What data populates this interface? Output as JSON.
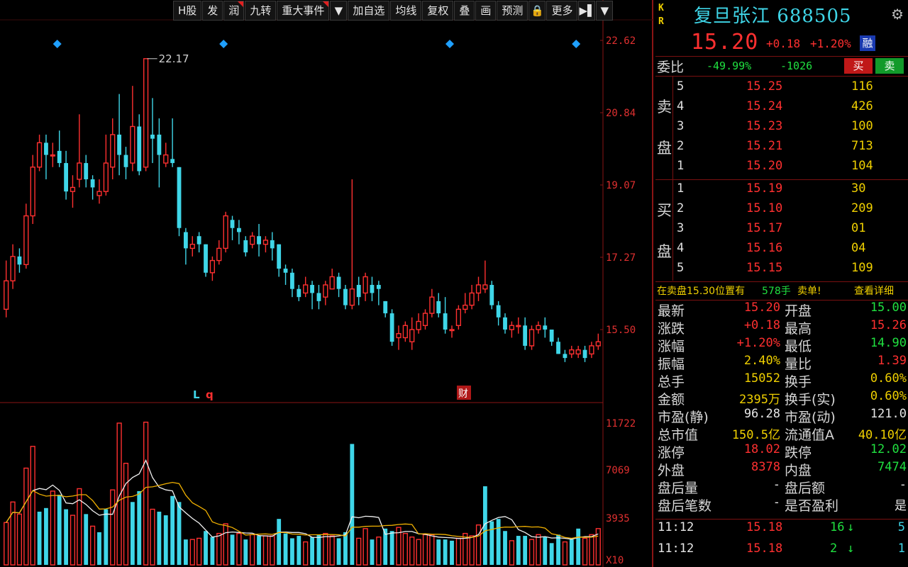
{
  "toolbar": {
    "items": [
      "H股",
      "发",
      "润",
      "九转",
      "重大事件",
      "▼",
      "加自选",
      "均线",
      "复权",
      "叠",
      "画",
      "预测",
      "🔒",
      "更多",
      "▶▌",
      "▼"
    ]
  },
  "colors": {
    "up": "#ff3030",
    "down": "#3fd6e8",
    "axis": "#e03030",
    "ma5": "#f0f0f0",
    "ma10": "#f0b000"
  },
  "chart": {
    "price_axis": [
      "22.62",
      "20.84",
      "19.07",
      "17.27",
      "15.50"
    ],
    "volume_axis": [
      "11722",
      "7069",
      "3935",
      "X10"
    ],
    "peak_label": "22.17",
    "markers": [
      "L",
      "q",
      "财"
    ]
  },
  "chart_data": {
    "type": "candlestick",
    "ylim": [
      14.6,
      22.62
    ],
    "candles": [
      [
        16.0,
        16.7,
        15.8,
        17.2
      ],
      [
        16.7,
        17.3,
        16.5,
        17.6
      ],
      [
        17.3,
        17.1,
        16.9,
        17.5
      ],
      [
        17.1,
        18.3,
        17.0,
        18.6
      ],
      [
        18.3,
        19.5,
        18.1,
        19.8
      ],
      [
        19.5,
        20.1,
        19.4,
        20.3
      ],
      [
        20.1,
        19.8,
        19.2,
        20.3
      ],
      [
        19.8,
        19.8,
        19.5,
        20.1
      ],
      [
        19.9,
        19.6,
        19.5,
        20.4
      ],
      [
        19.6,
        18.9,
        18.7,
        19.9
      ],
      [
        18.9,
        19.0,
        18.5,
        19.3
      ],
      [
        19.2,
        19.6,
        19.0,
        20.8
      ],
      [
        19.6,
        19.2,
        19.0,
        19.8
      ],
      [
        19.2,
        19.0,
        18.7,
        19.3
      ],
      [
        18.8,
        18.9,
        18.6,
        19.2
      ],
      [
        18.9,
        19.6,
        18.8,
        20.3
      ],
      [
        19.5,
        20.3,
        19.2,
        20.7
      ],
      [
        20.3,
        19.8,
        19.3,
        21.3
      ],
      [
        19.8,
        19.5,
        19.2,
        20.0
      ],
      [
        19.6,
        20.5,
        19.4,
        21.5
      ],
      [
        20.5,
        19.4,
        19.3,
        20.8
      ],
      [
        19.5,
        22.17,
        19.4,
        22.17
      ],
      [
        20.3,
        20.2,
        19.6,
        21.2
      ],
      [
        20.3,
        19.8,
        19.0,
        20.7
      ],
      [
        19.6,
        19.8,
        19.5,
        20.1
      ],
      [
        19.7,
        19.6,
        19.5,
        20.7
      ],
      [
        19.5,
        18.0,
        17.8,
        19.5
      ],
      [
        17.9,
        17.5,
        17.1,
        18.0
      ],
      [
        17.5,
        17.6,
        17.3,
        17.8
      ],
      [
        17.8,
        17.6,
        17.4,
        17.9
      ],
      [
        17.6,
        16.9,
        16.8,
        17.6
      ],
      [
        16.9,
        17.2,
        16.7,
        17.3
      ],
      [
        17.2,
        17.5,
        17.1,
        17.7
      ],
      [
        17.5,
        18.3,
        17.4,
        18.4
      ],
      [
        18.2,
        18.0,
        17.7,
        18.3
      ],
      [
        18.0,
        17.9,
        17.6,
        18.2
      ],
      [
        17.7,
        17.4,
        17.3,
        17.8
      ],
      [
        17.6,
        17.8,
        17.5,
        17.9
      ],
      [
        17.8,
        17.6,
        17.3,
        18.1
      ],
      [
        17.6,
        17.7,
        17.4,
        17.8
      ],
      [
        17.7,
        17.5,
        17.2,
        17.9
      ],
      [
        17.6,
        17.0,
        16.8,
        17.6
      ],
      [
        17.0,
        16.9,
        16.6,
        17.1
      ],
      [
        16.9,
        16.5,
        16.3,
        17.0
      ],
      [
        16.5,
        16.3,
        16.2,
        16.6
      ],
      [
        16.4,
        16.6,
        16.3,
        16.8
      ],
      [
        16.6,
        16.4,
        16.0,
        16.7
      ],
      [
        16.4,
        16.2,
        16.0,
        16.6
      ],
      [
        16.3,
        16.6,
        16.1,
        16.7
      ],
      [
        16.5,
        16.8,
        16.5,
        17.0
      ],
      [
        16.8,
        16.5,
        16.3,
        16.9
      ],
      [
        16.5,
        16.1,
        16.0,
        16.6
      ],
      [
        16.1,
        16.5,
        16.0,
        19.2
      ],
      [
        16.6,
        16.3,
        16.1,
        16.8
      ],
      [
        16.4,
        16.8,
        16.2,
        16.9
      ],
      [
        16.6,
        16.4,
        16.2,
        16.8
      ],
      [
        16.6,
        16.5,
        16.1,
        16.7
      ],
      [
        16.2,
        15.9,
        15.8,
        16.2
      ],
      [
        15.9,
        15.2,
        15.1,
        16.0
      ],
      [
        15.3,
        15.4,
        15.0,
        15.6
      ],
      [
        15.3,
        15.6,
        15.2,
        15.7
      ],
      [
        15.2,
        15.5,
        15.0,
        15.8
      ],
      [
        15.5,
        15.7,
        15.4,
        15.9
      ],
      [
        15.6,
        15.9,
        15.5,
        16.0
      ],
      [
        15.9,
        16.3,
        15.8,
        16.5
      ],
      [
        16.2,
        15.9,
        15.8,
        16.4
      ],
      [
        15.9,
        15.5,
        15.4,
        16.3
      ],
      [
        15.5,
        15.5,
        15.3,
        15.6
      ],
      [
        15.6,
        16.0,
        15.5,
        16.1
      ],
      [
        16.0,
        16.1,
        15.9,
        16.4
      ],
      [
        16.1,
        16.4,
        16.0,
        16.6
      ],
      [
        16.4,
        16.6,
        16.2,
        16.8
      ],
      [
        16.5,
        16.6,
        16.4,
        17.2
      ],
      [
        16.6,
        16.1,
        16.0,
        16.7
      ],
      [
        16.1,
        15.8,
        15.6,
        16.2
      ],
      [
        15.8,
        15.5,
        15.4,
        15.9
      ],
      [
        15.5,
        15.6,
        15.3,
        15.7
      ],
      [
        15.6,
        15.6,
        15.4,
        15.8
      ],
      [
        15.6,
        15.1,
        15.0,
        15.8
      ],
      [
        15.1,
        15.5,
        15.0,
        15.6
      ],
      [
        15.5,
        15.6,
        15.4,
        15.7
      ],
      [
        15.6,
        15.5,
        15.3,
        15.8
      ],
      [
        15.5,
        15.2,
        15.1,
        15.5
      ],
      [
        15.2,
        14.9,
        14.9,
        15.3
      ],
      [
        14.9,
        14.8,
        14.7,
        15.0
      ],
      [
        14.9,
        15.0,
        14.8,
        15.1
      ],
      [
        14.9,
        15.0,
        14.8,
        15.1
      ],
      [
        15.0,
        14.8,
        14.7,
        15.1
      ],
      [
        14.9,
        15.1,
        14.8,
        15.2
      ],
      [
        15.1,
        15.2,
        15.0,
        15.4
      ]
    ],
    "volumes": [
      [
        3500,
        1
      ],
      [
        5200,
        1
      ],
      [
        4200,
        1
      ],
      [
        8000,
        1
      ],
      [
        9800,
        1
      ],
      [
        4400,
        0
      ],
      [
        4700,
        0
      ],
      [
        6100,
        1
      ],
      [
        5800,
        0
      ],
      [
        4600,
        0
      ],
      [
        4100,
        1
      ],
      [
        6300,
        1
      ],
      [
        4200,
        0
      ],
      [
        3200,
        1
      ],
      [
        2700,
        0
      ],
      [
        4600,
        0
      ],
      [
        6200,
        1
      ],
      [
        11722,
        1
      ],
      [
        8400,
        1
      ],
      [
        5200,
        0
      ],
      [
        6100,
        0
      ],
      [
        11800,
        1
      ],
      [
        4600,
        1
      ],
      [
        4400,
        0
      ],
      [
        4100,
        0
      ],
      [
        5700,
        0
      ],
      [
        5200,
        0
      ],
      [
        2100,
        0
      ],
      [
        2100,
        1
      ],
      [
        2200,
        1
      ],
      [
        2800,
        0
      ],
      [
        2300,
        0
      ],
      [
        2600,
        1
      ],
      [
        3400,
        1
      ],
      [
        2500,
        0
      ],
      [
        2600,
        1
      ],
      [
        2100,
        0
      ],
      [
        2500,
        1
      ],
      [
        2400,
        0
      ],
      [
        2400,
        1
      ],
      [
        2400,
        1
      ],
      [
        3800,
        0
      ],
      [
        2600,
        0
      ],
      [
        2200,
        0
      ],
      [
        2400,
        0
      ],
      [
        1900,
        1
      ],
      [
        2300,
        0
      ],
      [
        2500,
        0
      ],
      [
        2600,
        1
      ],
      [
        2400,
        1
      ],
      [
        2200,
        0
      ],
      [
        2700,
        0
      ],
      [
        10000,
        0
      ],
      [
        2200,
        1
      ],
      [
        3000,
        1
      ],
      [
        2100,
        0
      ],
      [
        2300,
        1
      ],
      [
        3000,
        0
      ],
      [
        2800,
        0
      ],
      [
        3100,
        1
      ],
      [
        2600,
        1
      ],
      [
        2300,
        1
      ],
      [
        2100,
        1
      ],
      [
        2500,
        1
      ],
      [
        2500,
        1
      ],
      [
        2100,
        0
      ],
      [
        2100,
        0
      ],
      [
        2000,
        0
      ],
      [
        2200,
        1
      ],
      [
        2600,
        1
      ],
      [
        2400,
        1
      ],
      [
        3300,
        1
      ],
      [
        6500,
        0
      ],
      [
        3600,
        0
      ],
      [
        3800,
        0
      ],
      [
        2800,
        0
      ],
      [
        2000,
        1
      ],
      [
        2400,
        0
      ],
      [
        2400,
        0
      ],
      [
        2100,
        1
      ],
      [
        2500,
        1
      ],
      [
        2300,
        0
      ],
      [
        1800,
        0
      ],
      [
        2500,
        0
      ],
      [
        1900,
        1
      ],
      [
        2100,
        0
      ],
      [
        3000,
        0
      ],
      [
        2200,
        1
      ],
      [
        2500,
        1
      ],
      [
        3000,
        1
      ]
    ]
  },
  "panel": {
    "kr": [
      "K",
      "R"
    ],
    "name": "复旦张江",
    "code": "688505",
    "price": "15.20",
    "change": "+0.18",
    "change_pct": "+1.20%",
    "rong": "融",
    "weibi_label": "委比",
    "weibi_pct": "-49.99%",
    "weibi_diff": "-1026",
    "buy_btn": "买",
    "sell_btn": "卖",
    "sell_label": [
      "卖",
      "盘"
    ],
    "buy_label": [
      "买",
      "盘"
    ],
    "sell_book": [
      {
        "lvl": "5",
        "price": "15.25",
        "vol": "116"
      },
      {
        "lvl": "4",
        "price": "15.24",
        "vol": "426"
      },
      {
        "lvl": "3",
        "price": "15.23",
        "vol": "100"
      },
      {
        "lvl": "2",
        "price": "15.21",
        "vol": "713"
      },
      {
        "lvl": "1",
        "price": "15.20",
        "vol": "104"
      }
    ],
    "buy_book": [
      {
        "lvl": "1",
        "price": "15.19",
        "vol": "30"
      },
      {
        "lvl": "2",
        "price": "15.10",
        "vol": "209"
      },
      {
        "lvl": "3",
        "price": "15.17",
        "vol": "01"
      },
      {
        "lvl": "4",
        "price": "15.16",
        "vol": "04"
      },
      {
        "lvl": "5",
        "price": "15.15",
        "vol": "109"
      }
    ],
    "notice": {
      "text": "在卖盘15.30位置有",
      "qty": "578手",
      "tail": "卖单!",
      "link": "查看详细"
    },
    "stats": [
      {
        "l1": "最新",
        "v1": "15.20",
        "c1": "red",
        "l2": "开盘",
        "v2": "15.00",
        "c2": "green"
      },
      {
        "l1": "涨跌",
        "v1": "+0.18",
        "c1": "red",
        "l2": "最高",
        "v2": "15.26",
        "c2": "red"
      },
      {
        "l1": "涨幅",
        "v1": "+1.20%",
        "c1": "red",
        "l2": "最低",
        "v2": "14.90",
        "c2": "green"
      },
      {
        "l1": "振幅",
        "v1": "2.40%",
        "c1": "yellow",
        "l2": "量比",
        "v2": "1.39",
        "c2": "red"
      },
      {
        "l1": "总手",
        "v1": "15052",
        "c1": "yellow",
        "l2": "换手",
        "v2": "0.60%",
        "c2": "yellow"
      },
      {
        "l1": "金额",
        "v1": "2395万",
        "c1": "yellow",
        "l2": "换手(实)",
        "v2": "0.60%",
        "c2": "yellow"
      },
      {
        "l1": "市盈(静)",
        "v1": "96.28",
        "c1": "white",
        "l2": "市盈(动)",
        "v2": "121.0",
        "c2": "white"
      },
      {
        "l1": "总市值",
        "v1": "150.5亿",
        "c1": "yellow",
        "l2": "流通值A",
        "v2": "40.10亿",
        "c2": "yellow"
      },
      {
        "l1": "涨停",
        "v1": "18.02",
        "c1": "red",
        "l2": "跌停",
        "v2": "12.02",
        "c2": "green"
      },
      {
        "l1": "外盘",
        "v1": "8378",
        "c1": "red",
        "l2": "内盘",
        "v2": "7474",
        "c2": "green"
      },
      {
        "l1": "盘后量",
        "v1": "-",
        "c1": "white",
        "l2": "盘后额",
        "v2": "-",
        "c2": "white"
      },
      {
        "l1": "盘后笔数",
        "v1": "-",
        "c1": "white",
        "l2": "是否盈利",
        "v2": "是",
        "c2": "white"
      }
    ],
    "ticks": [
      {
        "time": "11:12",
        "price": "15.18",
        "vol": "16",
        "arrow": "↓",
        "count": "5"
      },
      {
        "time": "11:12",
        "price": "15.18",
        "vol": "2",
        "arrow": "↓",
        "count": "1"
      }
    ]
  }
}
